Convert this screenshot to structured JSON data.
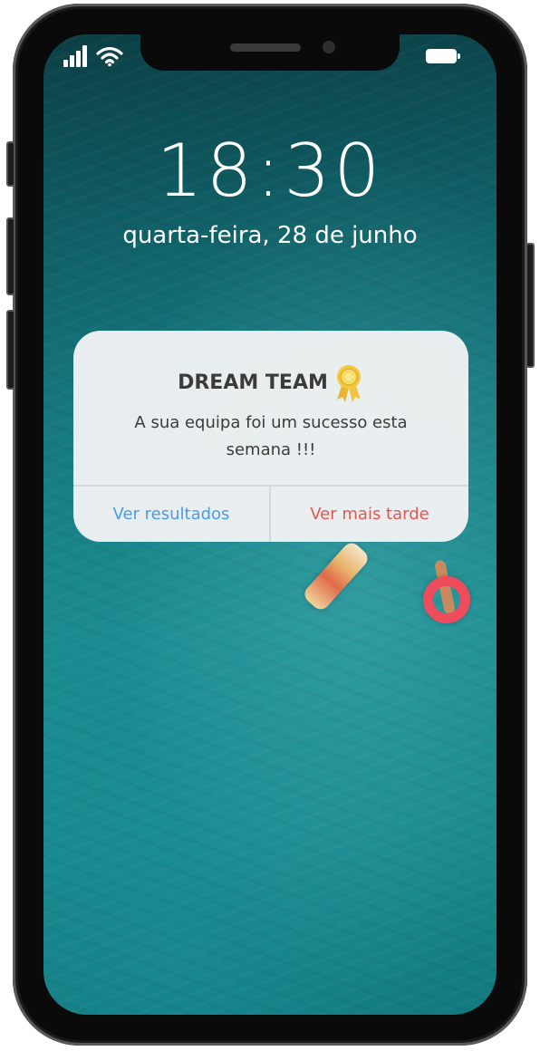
{
  "status_bar": {
    "signal_icon": "signal-bars-icon",
    "wifi_icon": "wifi-icon",
    "battery_icon": "battery-full-icon"
  },
  "lock_screen": {
    "time": "18:30",
    "date": "quarta-feira, 28 de junho"
  },
  "notification": {
    "title": "DREAM TEAM",
    "title_icon": "award-ribbon-icon",
    "message": "A sua equipa foi um sucesso esta semana !!!",
    "actions": [
      {
        "label": "Ver resultados",
        "color": "#4a9be8"
      },
      {
        "label": "Ver mais tarde",
        "color": "#e8554f"
      }
    ]
  },
  "colors": {
    "frame": "#0a0a0a",
    "wallpaper": "#17888c",
    "notification_bg": "#eff2f3",
    "text": "#3b3b3b"
  }
}
